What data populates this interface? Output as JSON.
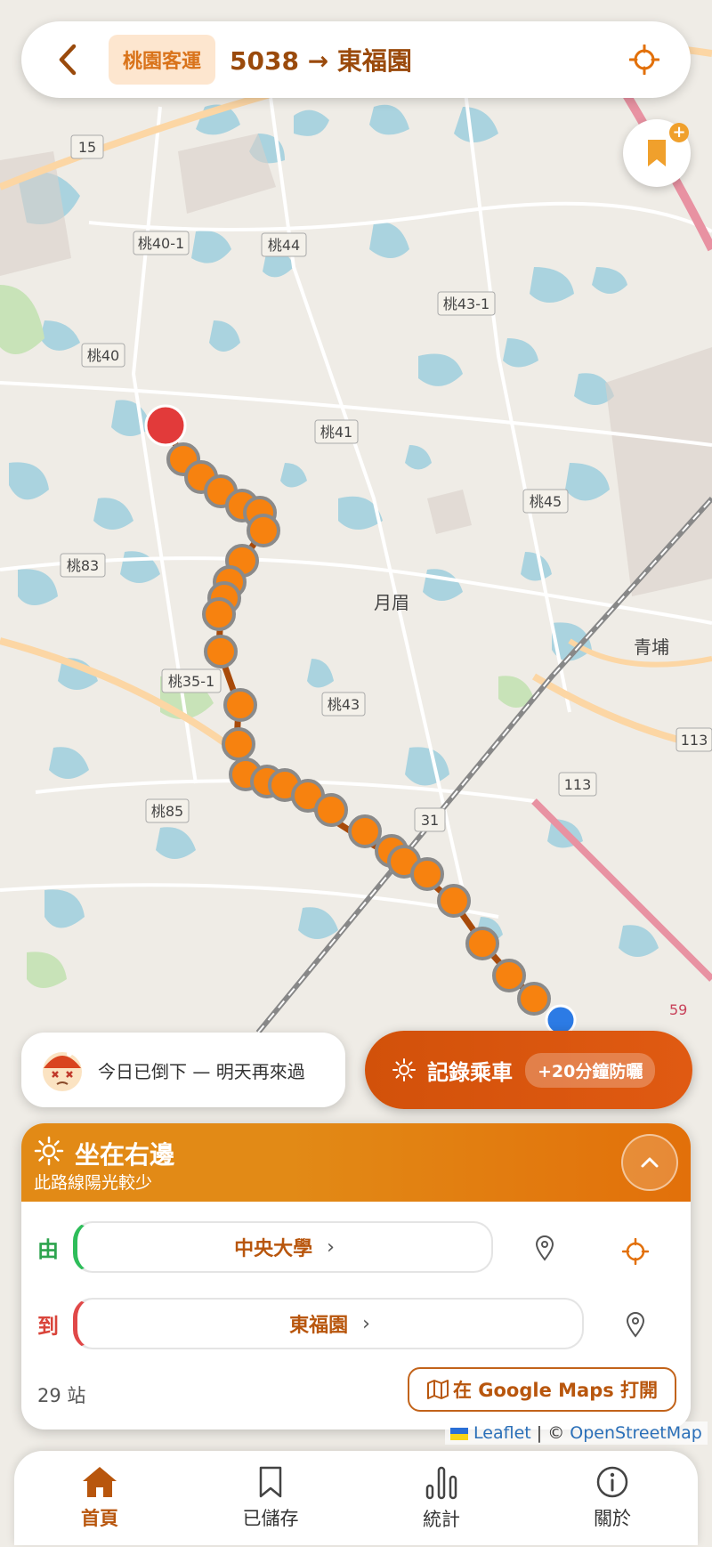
{
  "header": {
    "operator": "桃園客運",
    "route": "5038 → 東福園",
    "back_icon": "chevron-left-icon",
    "locate_icon": "crosshair-icon"
  },
  "map": {
    "road_labels": [
      "15",
      "桃40-1",
      "桃44",
      "桃43-1",
      "桃40",
      "桃41",
      "桃45",
      "桃83",
      "月眉",
      "青埔",
      "桃35-1",
      "桃43",
      "113",
      "113",
      "桃85",
      "31",
      "59"
    ],
    "attribution_leaflet": "Leaflet",
    "attribution_sep": " | © ",
    "attribution_osm": "OpenStreetMap"
  },
  "status": {
    "text": "今日已倒下 — 明天再來過"
  },
  "record": {
    "label": "記錄乘車",
    "badge": "+20分鐘防曬"
  },
  "panel": {
    "title": "坐在右邊",
    "subtitle": "此路線陽光較少",
    "from_label": "由",
    "from_stop": "中央大學",
    "to_label": "到",
    "to_stop": "東福園",
    "stop_count": "29 站",
    "gmaps_label": "在 Google Maps 打開"
  },
  "tabs": [
    {
      "label": "首頁",
      "icon": "home-icon"
    },
    {
      "label": "已儲存",
      "icon": "bookmark-icon"
    },
    {
      "label": "統計",
      "icon": "stats-icon"
    },
    {
      "label": "關於",
      "icon": "info-icon"
    }
  ],
  "colors": {
    "accent": "#e2700a",
    "route": "#f7820f",
    "start_marker": "#e23a3a",
    "user_marker": "#2c7be5"
  }
}
